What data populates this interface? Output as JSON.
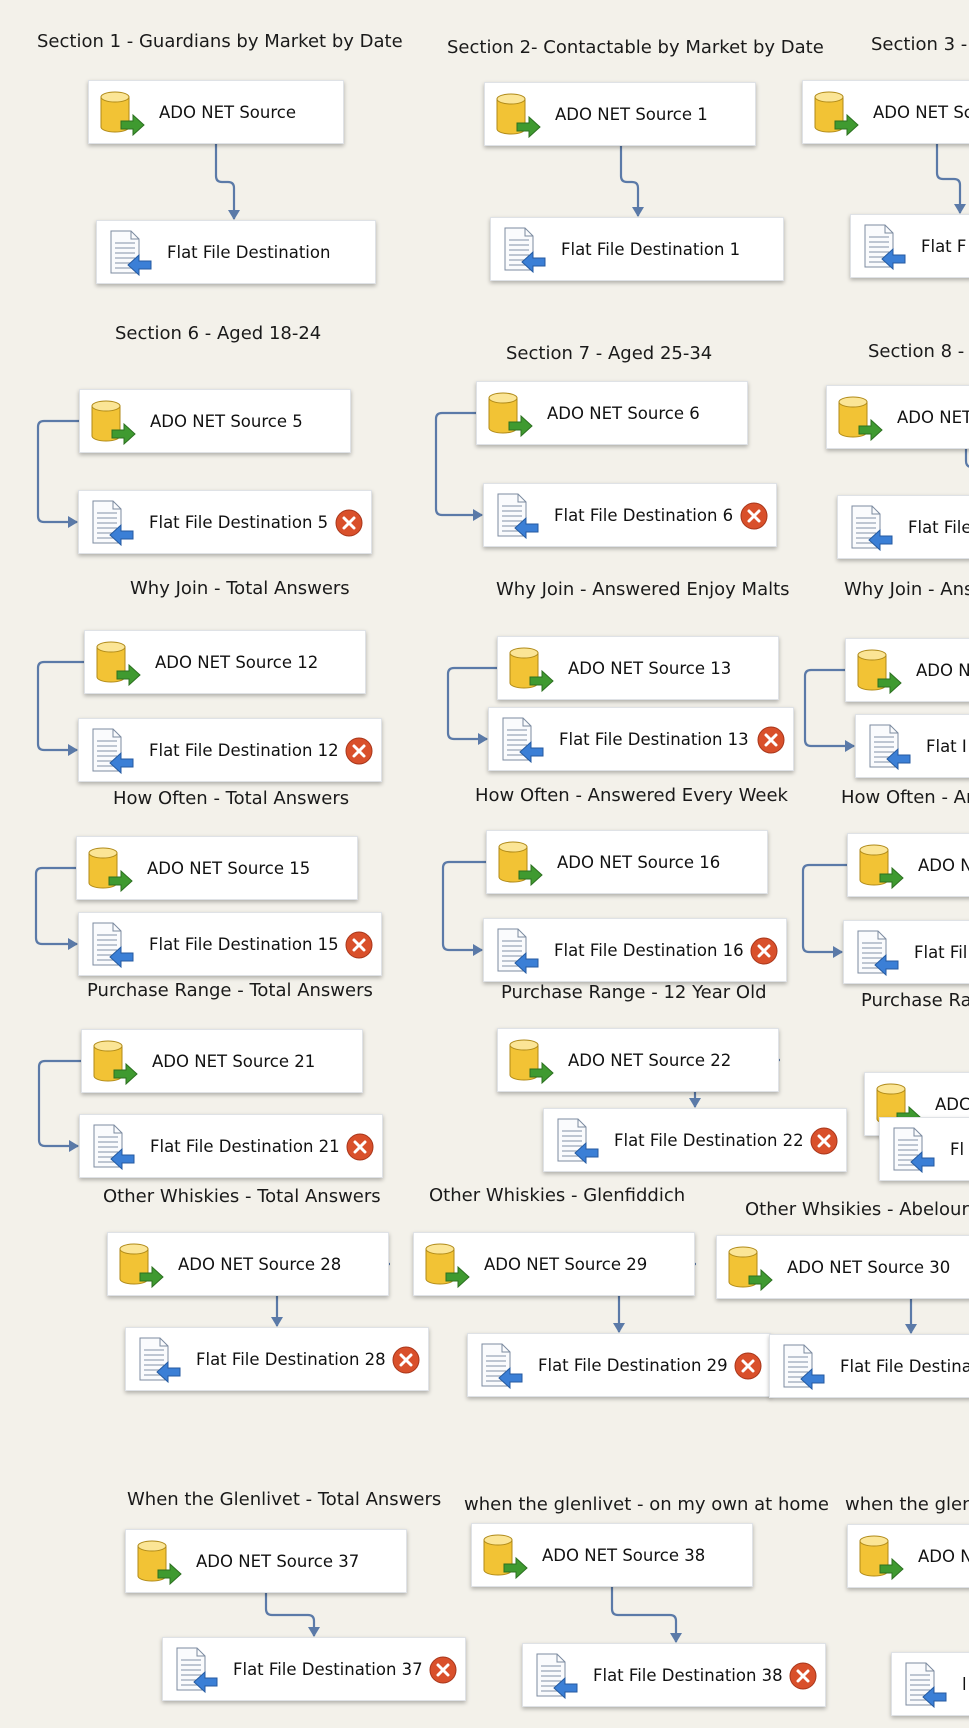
{
  "colors": {
    "background": "#f3f1ea",
    "connector": "#5b7aa8",
    "error": "#d9502b",
    "db_body": "#f2c335",
    "src_arrow": "#3f9a30",
    "dst_arrow": "#3b7fd6"
  },
  "icons": {
    "source": "database-source-icon",
    "destination": "flat-file-destination-icon",
    "error": "error-icon"
  },
  "groups": [
    {
      "title": "Section 1 - Guardians by Market by Date",
      "source": "ADO NET Source",
      "dest": "Flat File Destination",
      "dest_error": false
    },
    {
      "title": "Section 2- Contactable by Market by Date",
      "source": "ADO NET Source 1",
      "dest": "Flat File Destination 1",
      "dest_error": false
    },
    {
      "title": "Section 3 -",
      "source": "ADO NET Sc",
      "dest": "Flat F",
      "dest_error": false
    },
    {
      "title": "Section 6 - Aged 18-24",
      "source": "ADO NET Source 5",
      "dest": "Flat File Destination 5",
      "dest_error": true
    },
    {
      "title": "Section 7 - Aged 25-34",
      "source": "ADO NET Source 6",
      "dest": "Flat File Destination 6",
      "dest_error": true
    },
    {
      "title": "Section 8 - /",
      "source": "ADO NET",
      "dest": "Flat File",
      "dest_error": false
    },
    {
      "title": "Why Join - Total Answers",
      "source": "ADO NET Source 12",
      "dest": "Flat File Destination 12",
      "dest_error": true
    },
    {
      "title": "Why Join - Answered Enjoy Malts",
      "source": "ADO NET Source 13",
      "dest": "Flat File Destination 13",
      "dest_error": true
    },
    {
      "title": "Why Join - Ans",
      "source": "ADO N",
      "dest": "Flat I",
      "dest_error": false
    },
    {
      "title": "How Often - Total Answers",
      "source": "ADO NET Source 15",
      "dest": "Flat File Destination 15",
      "dest_error": true
    },
    {
      "title": "How Often - Answered Every Week",
      "source": "ADO NET Source 16",
      "dest": "Flat File Destination 16",
      "dest_error": true
    },
    {
      "title": "How Often - Ar",
      "source": "ADO N",
      "dest": "Flat Fil",
      "dest_error": false
    },
    {
      "title": "Purchase Range - Total Answers",
      "source": "ADO NET Source 21",
      "dest": "Flat File Destination 21",
      "dest_error": true
    },
    {
      "title": "Purchase Range - 12 Year Old",
      "source": "ADO NET Source 22",
      "dest": "Flat File Destination 22",
      "dest_error": true
    },
    {
      "title": "Purchase Ran",
      "source": "ADC",
      "dest": "Fl",
      "dest_error": false
    },
    {
      "title": "Other Whiskies - Total Answers",
      "source": "ADO NET Source 28",
      "dest": "Flat File Destination 28",
      "dest_error": true
    },
    {
      "title": "Other Whiskies - Glenfiddich",
      "source": "ADO NET Source 29",
      "dest": "Flat File Destination 29",
      "dest_error": true
    },
    {
      "title": "Other Whsikies - Abelour",
      "source": "ADO NET Source 30",
      "dest": "Flat File Destinati",
      "dest_error": false
    },
    {
      "title": "When the Glenlivet - Total Answers",
      "source": "ADO NET Source 37",
      "dest": "Flat File Destination 37",
      "dest_error": true
    },
    {
      "title": "when the glenlivet - on my own at home",
      "source": "ADO NET Source 38",
      "dest": "Flat File Destination 38",
      "dest_error": true
    },
    {
      "title": "when the glen",
      "source": "ADO N",
      "dest": "l",
      "dest_error": false
    }
  ]
}
